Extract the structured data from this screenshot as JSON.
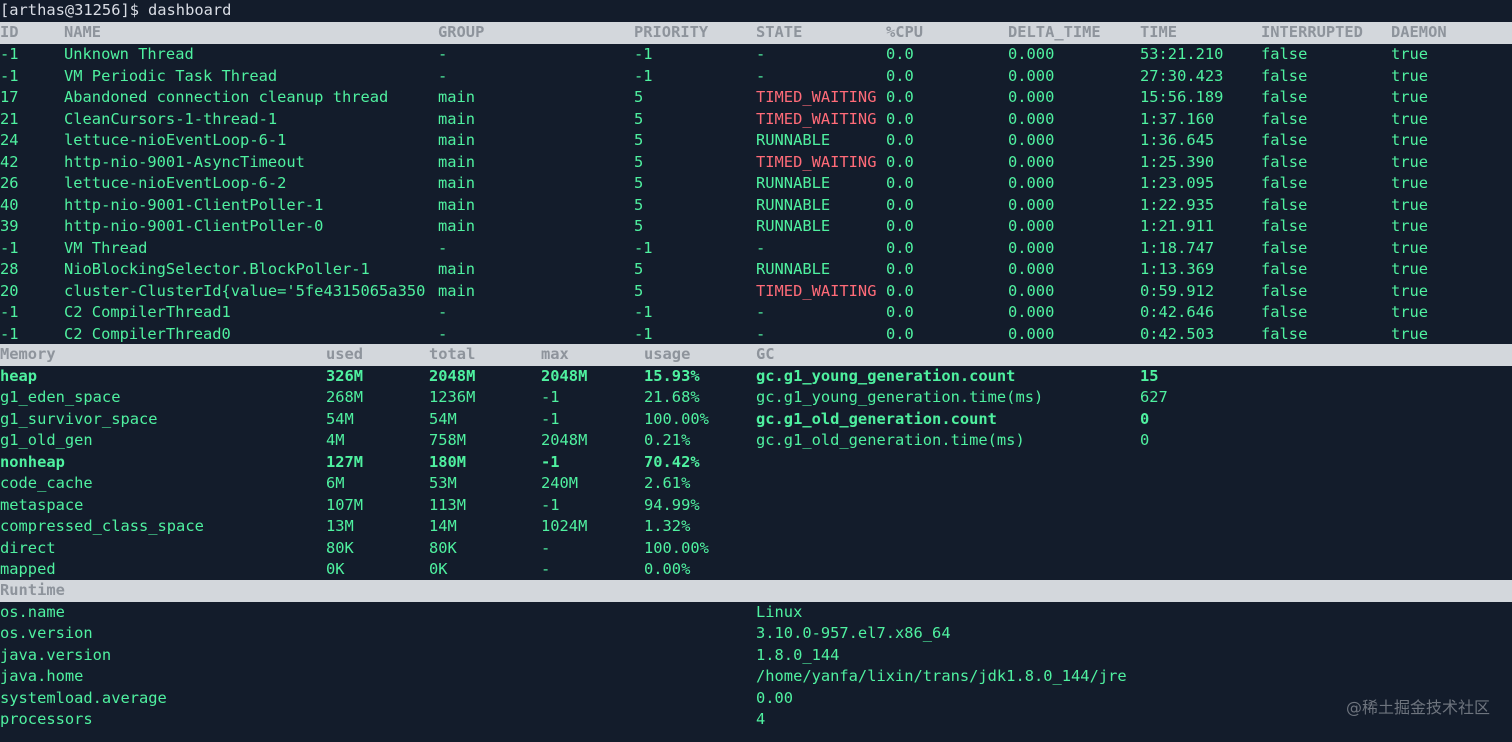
{
  "terminal": {
    "prompt": "[arthas@31256]$",
    "command": "dashboard"
  },
  "threads": {
    "headers": [
      "ID",
      "NAME",
      "GROUP",
      "PRIORITY",
      "STATE",
      "%CPU",
      "DELTA_TIME",
      "TIME",
      "INTERRUPTED",
      "DAEMON"
    ],
    "rows": [
      {
        "id": "-1",
        "name": "Unknown Thread",
        "group": "-",
        "priority": "-1",
        "state": "-",
        "cpu": "0.0",
        "delta": "0.000",
        "time": "53:21.210",
        "interrupted": "false",
        "daemon": "true"
      },
      {
        "id": "-1",
        "name": "VM Periodic Task Thread",
        "group": "-",
        "priority": "-1",
        "state": "-",
        "cpu": "0.0",
        "delta": "0.000",
        "time": "27:30.423",
        "interrupted": "false",
        "daemon": "true"
      },
      {
        "id": "17",
        "name": "Abandoned connection cleanup thread",
        "group": "main",
        "priority": "5",
        "state": "TIMED_WAITING",
        "cpu": "0.0",
        "delta": "0.000",
        "time": "15:56.189",
        "interrupted": "false",
        "daemon": "true"
      },
      {
        "id": "21",
        "name": "CleanCursors-1-thread-1",
        "group": "main",
        "priority": "5",
        "state": "TIMED_WAITING",
        "cpu": "0.0",
        "delta": "0.000",
        "time": "1:37.160",
        "interrupted": "false",
        "daemon": "true"
      },
      {
        "id": "24",
        "name": "lettuce-nioEventLoop-6-1",
        "group": "main",
        "priority": "5",
        "state": "RUNNABLE",
        "cpu": "0.0",
        "delta": "0.000",
        "time": "1:36.645",
        "interrupted": "false",
        "daemon": "true"
      },
      {
        "id": "42",
        "name": "http-nio-9001-AsyncTimeout",
        "group": "main",
        "priority": "5",
        "state": "TIMED_WAITING",
        "cpu": "0.0",
        "delta": "0.000",
        "time": "1:25.390",
        "interrupted": "false",
        "daemon": "true"
      },
      {
        "id": "26",
        "name": "lettuce-nioEventLoop-6-2",
        "group": "main",
        "priority": "5",
        "state": "RUNNABLE",
        "cpu": "0.0",
        "delta": "0.000",
        "time": "1:23.095",
        "interrupted": "false",
        "daemon": "true"
      },
      {
        "id": "40",
        "name": "http-nio-9001-ClientPoller-1",
        "group": "main",
        "priority": "5",
        "state": "RUNNABLE",
        "cpu": "0.0",
        "delta": "0.000",
        "time": "1:22.935",
        "interrupted": "false",
        "daemon": "true"
      },
      {
        "id": "39",
        "name": "http-nio-9001-ClientPoller-0",
        "group": "main",
        "priority": "5",
        "state": "RUNNABLE",
        "cpu": "0.0",
        "delta": "0.000",
        "time": "1:21.911",
        "interrupted": "false",
        "daemon": "true"
      },
      {
        "id": "-1",
        "name": "VM Thread",
        "group": "-",
        "priority": "-1",
        "state": "-",
        "cpu": "0.0",
        "delta": "0.000",
        "time": "1:18.747",
        "interrupted": "false",
        "daemon": "true"
      },
      {
        "id": "28",
        "name": "NioBlockingSelector.BlockPoller-1",
        "group": "main",
        "priority": "5",
        "state": "RUNNABLE",
        "cpu": "0.0",
        "delta": "0.000",
        "time": "1:13.369",
        "interrupted": "false",
        "daemon": "true"
      },
      {
        "id": "20",
        "name": "cluster-ClusterId{value='5fe4315065a350",
        "group": "main",
        "priority": "5",
        "state": "TIMED_WAITING",
        "cpu": "0.0",
        "delta": "0.000",
        "time": "0:59.912",
        "interrupted": "false",
        "daemon": "true"
      },
      {
        "id": "-1",
        "name": "C2 CompilerThread1",
        "group": "-",
        "priority": "-1",
        "state": "-",
        "cpu": "0.0",
        "delta": "0.000",
        "time": "0:42.646",
        "interrupted": "false",
        "daemon": "true"
      },
      {
        "id": "-1",
        "name": "C2 CompilerThread0",
        "group": "-",
        "priority": "-1",
        "state": "-",
        "cpu": "0.0",
        "delta": "0.000",
        "time": "0:42.503",
        "interrupted": "false",
        "daemon": "true"
      }
    ]
  },
  "memory": {
    "headers": [
      "Memory",
      "used",
      "total",
      "max",
      "usage",
      "GC"
    ],
    "rows": [
      {
        "name": "heap",
        "used": "326M",
        "total": "2048M",
        "max": "2048M",
        "usage": "15.93%",
        "gc_name": "gc.g1_young_generation.count",
        "gc_value": "15",
        "bold": true,
        "gc_bold": true
      },
      {
        "name": "g1_eden_space",
        "used": "268M",
        "total": "1236M",
        "max": "-1",
        "usage": "21.68%",
        "gc_name": "gc.g1_young_generation.time(ms)",
        "gc_value": "627",
        "bold": false,
        "gc_bold": false
      },
      {
        "name": "g1_survivor_space",
        "used": "54M",
        "total": "54M",
        "max": "-1",
        "usage": "100.00%",
        "gc_name": "gc.g1_old_generation.count",
        "gc_value": "0",
        "bold": false,
        "gc_bold": true
      },
      {
        "name": "g1_old_gen",
        "used": "4M",
        "total": "758M",
        "max": "2048M",
        "usage": "0.21%",
        "gc_name": "gc.g1_old_generation.time(ms)",
        "gc_value": "0",
        "bold": false,
        "gc_bold": false
      },
      {
        "name": "nonheap",
        "used": "127M",
        "total": "180M",
        "max": "-1",
        "usage": "70.42%",
        "gc_name": "",
        "gc_value": "",
        "bold": true,
        "gc_bold": false
      },
      {
        "name": "code_cache",
        "used": "6M",
        "total": "53M",
        "max": "240M",
        "usage": "2.61%",
        "gc_name": "",
        "gc_value": "",
        "bold": false,
        "gc_bold": false
      },
      {
        "name": "metaspace",
        "used": "107M",
        "total": "113M",
        "max": "-1",
        "usage": "94.99%",
        "gc_name": "",
        "gc_value": "",
        "bold": false,
        "gc_bold": false
      },
      {
        "name": "compressed_class_space",
        "used": "13M",
        "total": "14M",
        "max": "1024M",
        "usage": "1.32%",
        "gc_name": "",
        "gc_value": "",
        "bold": false,
        "gc_bold": false
      },
      {
        "name": "direct",
        "used": "80K",
        "total": "80K",
        "max": "-",
        "usage": "100.00%",
        "gc_name": "",
        "gc_value": "",
        "bold": false,
        "gc_bold": false
      },
      {
        "name": "mapped",
        "used": "0K",
        "total": "0K",
        "max": "-",
        "usage": "0.00%",
        "gc_name": "",
        "gc_value": "",
        "bold": false,
        "gc_bold": false
      }
    ]
  },
  "runtime": {
    "header": "Runtime",
    "rows": [
      {
        "key": "os.name",
        "value": "Linux"
      },
      {
        "key": "os.version",
        "value": "3.10.0-957.el7.x86_64"
      },
      {
        "key": "java.version",
        "value": "1.8.0_144"
      },
      {
        "key": "java.home",
        "value": "/home/yanfa/lixin/trans/jdk1.8.0_144/jre"
      },
      {
        "key": "systemload.average",
        "value": "0.00"
      },
      {
        "key": "processors",
        "value": "4"
      }
    ]
  },
  "watermark": "@稀土掘金技术社区",
  "colors": {
    "background": "#131c2b",
    "text": "#4ff1a0",
    "timed_waiting": "#ff6b78",
    "header_bar": "#d3d7dc",
    "header_text": "#8e949c"
  }
}
